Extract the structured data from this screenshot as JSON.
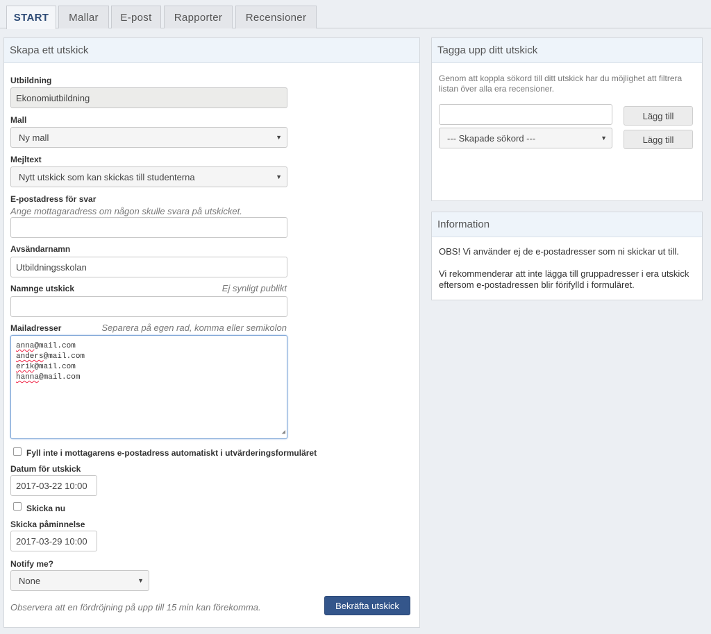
{
  "tabs": [
    "START",
    "Mallar",
    "E-post",
    "Rapporter",
    "Recensioner"
  ],
  "left_panel": {
    "title": "Skapa ett utskick",
    "utbildning": {
      "label": "Utbildning",
      "value": "Ekonomiutbildning"
    },
    "mall": {
      "label": "Mall",
      "value": "Ny mall"
    },
    "mejltext": {
      "label": "Mejltext",
      "value": "Nytt utskick som kan skickas till studenterna"
    },
    "reply": {
      "label": "E-postadress för svar",
      "hint": "Ange mottagaradress om någon skulle svara på utskicket.",
      "value": ""
    },
    "sender": {
      "label": "Avsändarnamn",
      "value": "Utbildningsskolan"
    },
    "name": {
      "label": "Namnge utskick",
      "hint": "Ej synligt publikt",
      "value": ""
    },
    "mail": {
      "label": "Mailadresser",
      "hint": "Separera på egen rad, komma eller semikolon",
      "addresses": [
        {
          "user": "anna",
          "domain": "@mail.com"
        },
        {
          "user": "anders",
          "domain": "@mail.com"
        },
        {
          "user": "erik",
          "domain": "@mail.com"
        },
        {
          "user": "hanna",
          "domain": "@mail.com"
        }
      ]
    },
    "autofill_label": "Fyll inte i mottagarens e-postadress automatiskt i utvärderingsformuläret",
    "date": {
      "label": "Datum för utskick",
      "value": "2017-03-22 10:00"
    },
    "send_now_label": "Skicka nu",
    "reminder": {
      "label": "Skicka påminnelse",
      "value": "2017-03-29 10:00"
    },
    "notify": {
      "label": "Notify me?",
      "value": "None"
    },
    "footer_note": "Observera att en fördröjning på upp till 15 min kan förekomma.",
    "confirm_button": "Bekräfta utskick"
  },
  "tag_panel": {
    "title": "Tagga upp ditt utskick",
    "description": "Genom att koppla sökord till ditt utskick har du möjlighet att filtrera listan över alla era recensioner.",
    "input_value": "",
    "select_value": "--- Skapade sökord ---",
    "add_button_1": "Lägg till",
    "add_button_2": "Lägg till"
  },
  "info_panel": {
    "title": "Information",
    "para1": "OBS! Vi använder ej de e-postadresser som ni skickar ut till.",
    "para2": "Vi rekommenderar att inte lägga till gruppadresser i era utskick eftersom e-postadressen blir förifylld i formuläret."
  },
  "colors": {
    "primary_button": "#34568b",
    "active_tab_text": "#2c4a75",
    "panel_header": "#eef4fa"
  }
}
